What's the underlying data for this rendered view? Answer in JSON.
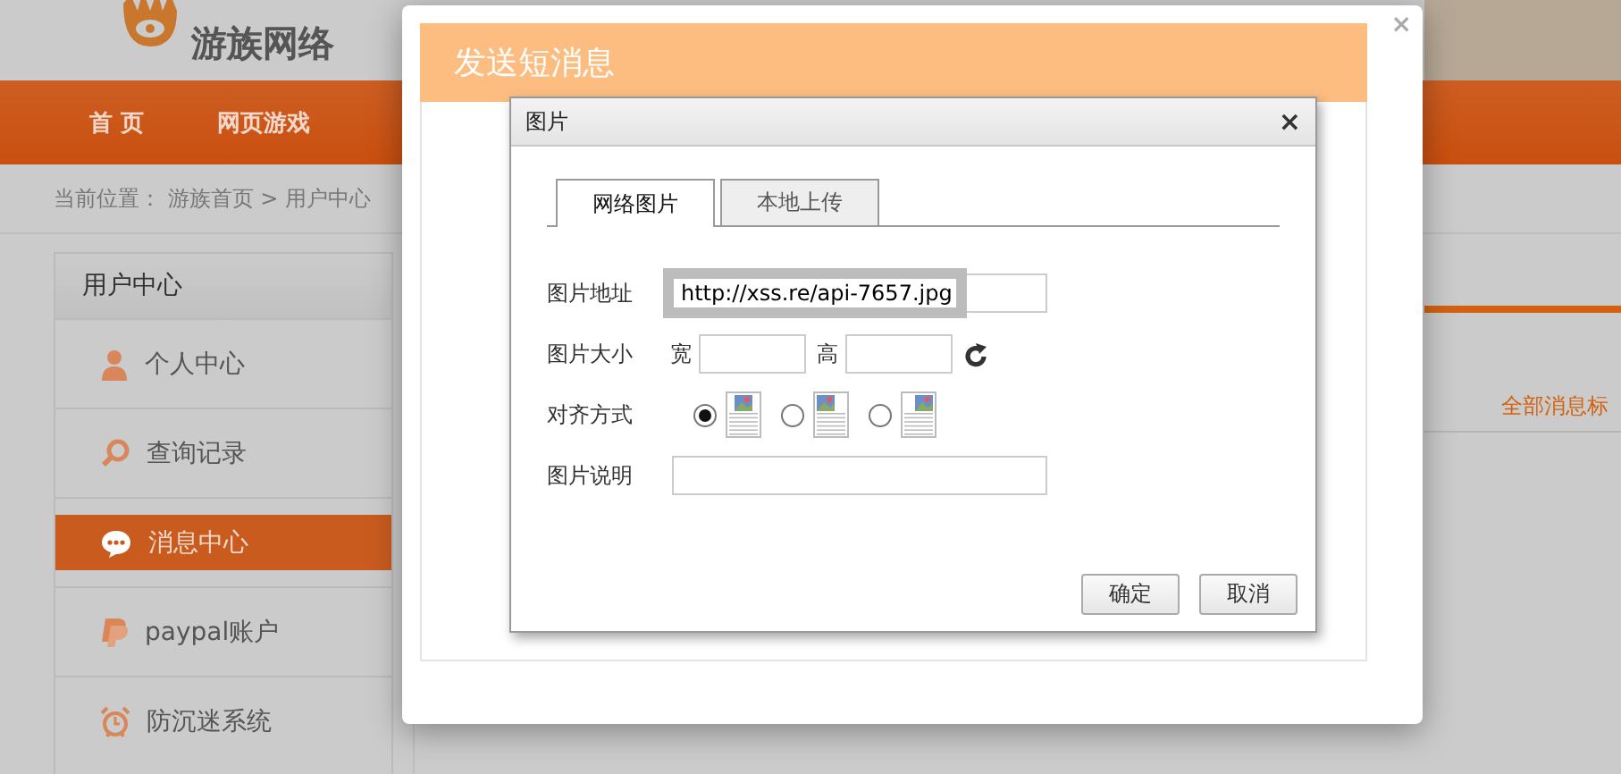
{
  "header": {
    "logo_name": "游族网络"
  },
  "nav": {
    "items": [
      {
        "label": "首 页"
      },
      {
        "label": "网页游戏"
      }
    ]
  },
  "breadcrumb": {
    "text": "当前位置： 游族首页 > 用户中心"
  },
  "sidebar": {
    "title": "用户中心",
    "items": [
      {
        "label": "个人中心",
        "selected": false
      },
      {
        "label": "查询记录",
        "selected": false
      },
      {
        "label": "消息中心",
        "selected": true
      },
      {
        "label": "paypal账户",
        "selected": false
      },
      {
        "label": "防沉迷系统",
        "selected": false
      }
    ]
  },
  "content": {
    "mark_all_link": "全部消息标"
  },
  "message_dialog": {
    "title": "发送短消息",
    "close": "×"
  },
  "image_dialog": {
    "title": "图片",
    "close": "×",
    "tabs": [
      {
        "label": "网络图片",
        "selected": true
      },
      {
        "label": "本地上传",
        "selected": false
      }
    ],
    "url": {
      "label": "图片地址",
      "value": "http://xss.re/api-7657.jpg"
    },
    "size": {
      "label": "图片大小",
      "width_label": "宽",
      "height_label": "高"
    },
    "align": {
      "label": "对齐方式",
      "options": [
        {
          "kind": "none",
          "selected": true
        },
        {
          "kind": "left",
          "selected": false
        },
        {
          "kind": "right",
          "selected": false
        }
      ]
    },
    "caption": {
      "label": "图片说明"
    },
    "buttons": [
      "确定",
      "取消"
    ]
  }
}
